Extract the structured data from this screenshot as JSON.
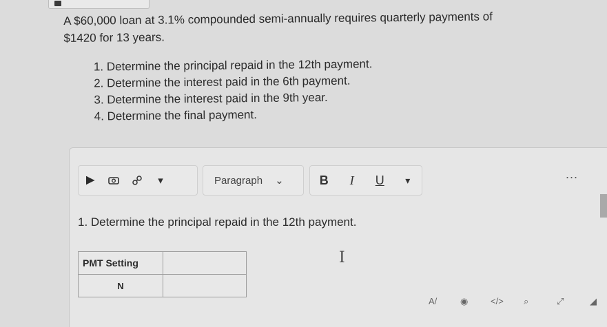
{
  "question": {
    "intro_line1": "A $60,000 loan at 3.1% compounded semi-annually requires quarterly payments of",
    "intro_line2": "$1420 for 13 years.",
    "items": [
      "Determine the principal repaid in the 12th payment.",
      "Determine the interest paid in the 6th payment.",
      "Determine the interest paid in the 9th year.",
      "Determine the final payment."
    ]
  },
  "toolbar": {
    "icons": [
      "play-icon",
      "camera-icon",
      "link-icon",
      "dropdown-arrow-icon"
    ],
    "paragraph_label": "Paragraph",
    "bold_label": "B",
    "italic_label": "I",
    "underline_label": "U",
    "more_label": "..."
  },
  "editor": {
    "content_line": "1. Determine the principal repaid in the 12th payment.",
    "table": {
      "header": "PMT Setting",
      "row1": "N"
    },
    "text_caret": "I"
  },
  "statusbar": {
    "icons": [
      "spellcheck-icon",
      "accessibility-icon",
      "code-icon",
      "find-icon",
      "fullscreen-icon",
      "resize-icon"
    ]
  }
}
